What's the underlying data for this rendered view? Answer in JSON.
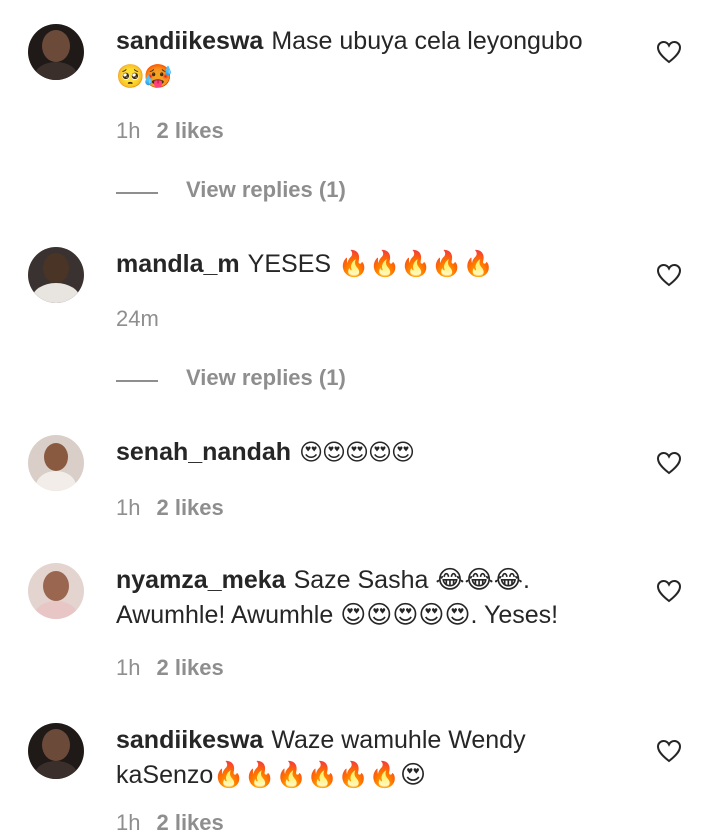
{
  "comments": [
    {
      "username": "sandiikeswa",
      "text": "Mase ubuya cela leyongubo",
      "text_line2": "🥺🥵",
      "time": "1h",
      "likes": "2 likes",
      "view_replies": "View replies (1)",
      "avatar": "woman-dark-hair-avatar"
    },
    {
      "username": "mandla_m",
      "text": "YESES 🔥🔥🔥🔥🔥",
      "time": "24m",
      "likes": "",
      "view_replies": "View replies (1)",
      "avatar": "man-white-jacket-avatar"
    },
    {
      "username": "senah_nandah",
      "text": "😍😍😍😍😍",
      "time": "1h",
      "likes": "2 likes",
      "avatar": "woman-light-avatar"
    },
    {
      "username": "nyamza_meka",
      "text": "Saze Sasha 😂😂😂.",
      "text_line2": "Awumhle! Awumhle 😍😍😍😍😍. Yeses!",
      "time": "1h",
      "likes": "2 likes",
      "avatar": "woman-pink-avatar"
    },
    {
      "username": "sandiikeswa",
      "text": "Waze wamuhle Wendy",
      "text_line2": "kaSenzo🔥🔥🔥🔥🔥🔥😍",
      "time": "1h",
      "likes": "2 likes",
      "avatar": "woman-dark-hair-avatar"
    }
  ],
  "icons": {
    "like": "heart-outline-icon"
  },
  "colors": {
    "text": "#262626",
    "secondary": "#8e8e8e",
    "background": "#ffffff"
  }
}
